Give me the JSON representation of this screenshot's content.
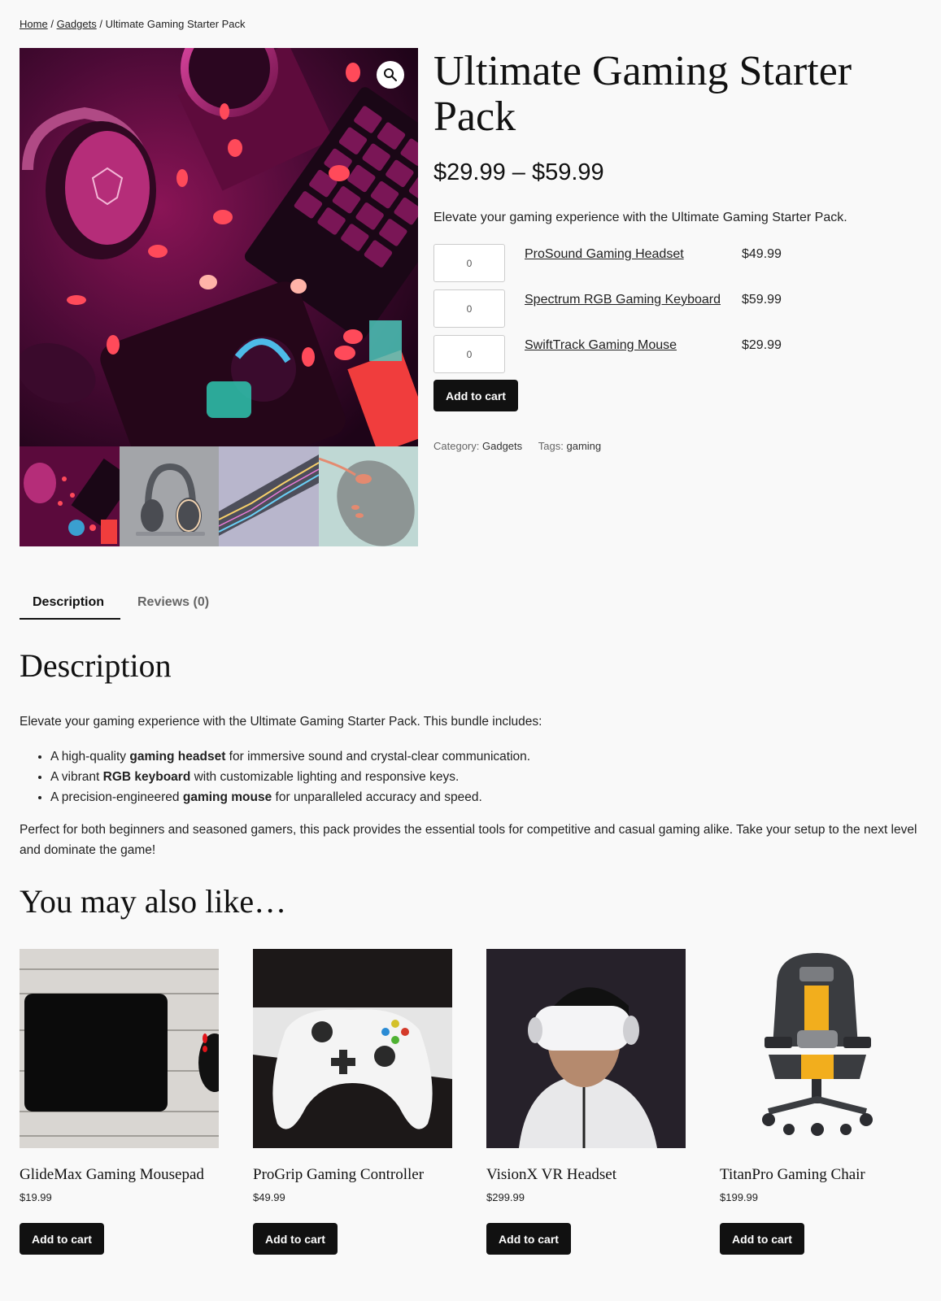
{
  "breadcrumb": {
    "items": [
      {
        "label": "Home",
        "link": true
      },
      {
        "label": "Gadgets",
        "link": true
      },
      {
        "label": "Ultimate Gaming Starter Pack",
        "link": false
      }
    ],
    "separator": "/"
  },
  "product": {
    "title": "Ultimate Gaming Starter Pack",
    "price_range": "$29.99 – $59.99",
    "short_description": "Elevate your gaming experience with the Ultimate Gaming Starter Pack.",
    "gallery": {
      "main_image": "gaming-setup-neon-photo",
      "zoom_icon": "magnifier-icon",
      "thumbnails": [
        "gaming-setup-neon",
        "headset",
        "rgb-keyboard",
        "gaming-mouse"
      ]
    },
    "grouped_items": [
      {
        "qty": "0",
        "name": "ProSound Gaming Headset",
        "price": "$49.99"
      },
      {
        "qty": "0",
        "name": "Spectrum RGB Gaming Keyboard",
        "price": "$59.99"
      },
      {
        "qty": "0",
        "name": "SwiftTrack Gaming Mouse",
        "price": "$29.99"
      }
    ],
    "add_to_cart_label": "Add to cart",
    "meta": {
      "category_label": "Category:",
      "category_value": "Gadgets",
      "tags_label": "Tags:",
      "tags_value": "gaming"
    }
  },
  "tabs": [
    {
      "label": "Description",
      "active": true
    },
    {
      "label": "Reviews (0)",
      "active": false
    }
  ],
  "description": {
    "heading": "Description",
    "intro": "Elevate your gaming experience with the Ultimate Gaming Starter Pack. This bundle includes:",
    "bullets": [
      {
        "pre": "A high-quality ",
        "bold": "gaming headset",
        "post": " for immersive sound and crystal-clear communication."
      },
      {
        "pre": "A vibrant ",
        "bold": "RGB keyboard",
        "post": " with customizable lighting and responsive keys."
      },
      {
        "pre": "A precision-engineered ",
        "bold": "gaming mouse",
        "post": " for unparalleled accuracy and speed."
      }
    ],
    "outro": "Perfect for both beginners and seasoned gamers, this pack provides the essential tools for competitive and casual gaming alike. Take your setup to the next level and dominate the game!"
  },
  "related": {
    "heading": "You may also like…",
    "products": [
      {
        "name": "GlideMax Gaming Mousepad",
        "price": "$19.99",
        "button": "Add to cart",
        "image": "mousepad"
      },
      {
        "name": "ProGrip Gaming Controller",
        "price": "$49.99",
        "button": "Add to cart",
        "image": "controller"
      },
      {
        "name": "VisionX VR Headset",
        "price": "$299.99",
        "button": "Add to cart",
        "image": "vr-headset"
      },
      {
        "name": "TitanPro Gaming Chair",
        "price": "$199.99",
        "button": "Add to cart",
        "image": "gaming-chair"
      }
    ]
  }
}
